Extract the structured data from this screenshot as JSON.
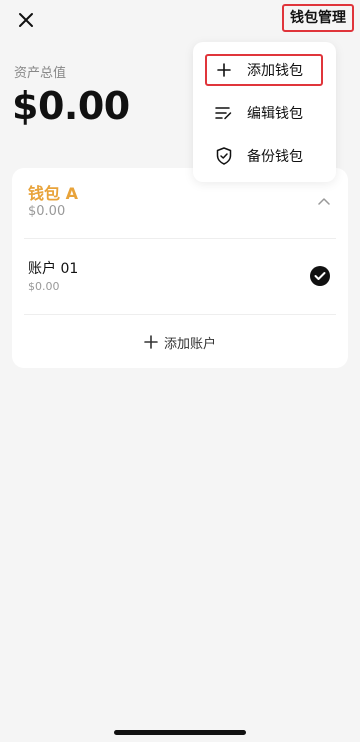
{
  "header": {
    "close_icon": "close-icon",
    "manage_label": "钱包管理"
  },
  "assets": {
    "label": "资产总值",
    "total": "$0.00"
  },
  "wallet": {
    "name": "钱包 A",
    "balance": "$0.00",
    "name_color": "#e8a33a",
    "account": {
      "name": "账户 01",
      "balance": "$0.00",
      "selected": true
    },
    "add_account_label": "添加账户"
  },
  "menu": {
    "items": [
      {
        "label": "添加钱包",
        "icon": "plus-icon",
        "highlighted": true
      },
      {
        "label": "编辑钱包",
        "icon": "edit-list-icon",
        "highlighted": false
      },
      {
        "label": "备份钱包",
        "icon": "shield-check-icon",
        "highlighted": false
      }
    ]
  },
  "colors": {
    "highlight_border": "#e0353b",
    "background": "#f5f5f5"
  }
}
